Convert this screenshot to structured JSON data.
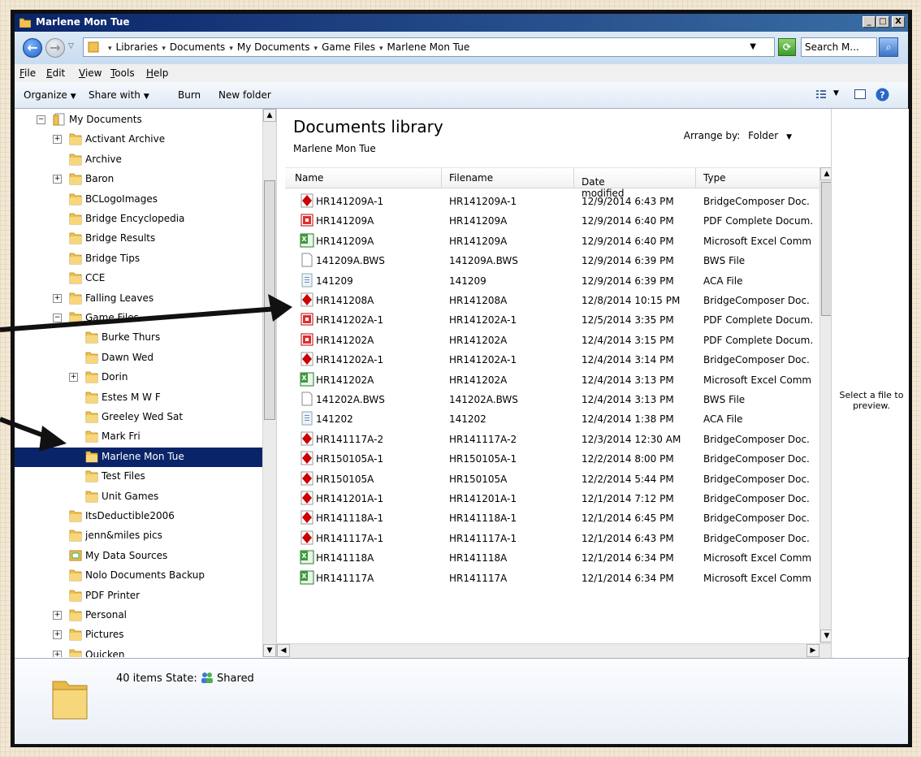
{
  "window": {
    "title": "Marlene Mon Tue",
    "controls": {
      "minimize": "_",
      "maximize": "□",
      "close": "X"
    }
  },
  "address": {
    "breadcrumbs": [
      "Libraries",
      "Documents",
      "My Documents",
      "Game Files",
      "Marlene Mon Tue"
    ],
    "search_text": "Search M..."
  },
  "menu": [
    "File",
    "Edit",
    "View",
    "Tools",
    "Help"
  ],
  "toolbar": {
    "organize": "Organize",
    "share_with": "Share with",
    "burn": "Burn",
    "new_folder": "New folder"
  },
  "nav": {
    "items": [
      {
        "label": "My Documents",
        "indent": 0,
        "expander": "⊟",
        "icon": "documents-icon"
      },
      {
        "label": "Activant Archive",
        "indent": 1,
        "expander": "⊞",
        "icon": "folder-icon"
      },
      {
        "label": "Archive",
        "indent": 1,
        "expander": "",
        "icon": "folder-icon"
      },
      {
        "label": "Baron",
        "indent": 1,
        "expander": "⊞",
        "icon": "folder-icon"
      },
      {
        "label": "BCLogoImages",
        "indent": 1,
        "expander": "",
        "icon": "folder-icon"
      },
      {
        "label": "Bridge Encyclopedia",
        "indent": 1,
        "expander": "",
        "icon": "folder-icon"
      },
      {
        "label": "Bridge Results",
        "indent": 1,
        "expander": "",
        "icon": "folder-icon"
      },
      {
        "label": "Bridge Tips",
        "indent": 1,
        "expander": "",
        "icon": "folder-icon"
      },
      {
        "label": "CCE",
        "indent": 1,
        "expander": "",
        "icon": "folder-icon"
      },
      {
        "label": "Falling Leaves",
        "indent": 1,
        "expander": "⊞",
        "icon": "folder-icon"
      },
      {
        "label": "Game Files",
        "indent": 1,
        "expander": "⊟",
        "icon": "folder-icon"
      },
      {
        "label": "Burke Thurs",
        "indent": 2,
        "expander": "",
        "icon": "folder-icon"
      },
      {
        "label": "Dawn Wed",
        "indent": 2,
        "expander": "",
        "icon": "folder-icon"
      },
      {
        "label": "Dorin",
        "indent": 2,
        "expander": "⊞",
        "icon": "folder-icon"
      },
      {
        "label": "Estes M W F",
        "indent": 2,
        "expander": "",
        "icon": "folder-icon"
      },
      {
        "label": "Greeley Wed Sat",
        "indent": 2,
        "expander": "",
        "icon": "folder-icon"
      },
      {
        "label": "Mark Fri",
        "indent": 2,
        "expander": "",
        "icon": "folder-icon"
      },
      {
        "label": "Marlene Mon Tue",
        "indent": 2,
        "expander": "",
        "icon": "folder-icon",
        "selected": true
      },
      {
        "label": "Test Files",
        "indent": 2,
        "expander": "",
        "icon": "folder-icon"
      },
      {
        "label": "Unit Games",
        "indent": 2,
        "expander": "",
        "icon": "folder-icon"
      },
      {
        "label": "ItsDeductible2006",
        "indent": 1,
        "expander": "",
        "icon": "folder-icon"
      },
      {
        "label": "jenn&miles pics",
        "indent": 1,
        "expander": "",
        "icon": "folder-icon"
      },
      {
        "label": "My Data Sources",
        "indent": 1,
        "expander": "",
        "icon": "data-sources-icon"
      },
      {
        "label": "Nolo Documents Backup",
        "indent": 1,
        "expander": "",
        "icon": "folder-icon"
      },
      {
        "label": "PDF Printer",
        "indent": 1,
        "expander": "",
        "icon": "folder-icon"
      },
      {
        "label": "Personal",
        "indent": 1,
        "expander": "⊞",
        "icon": "folder-icon"
      },
      {
        "label": "Pictures",
        "indent": 1,
        "expander": "⊞",
        "icon": "folder-icon"
      },
      {
        "label": "Quicken",
        "indent": 1,
        "expander": "⊞",
        "icon": "folder-icon"
      }
    ]
  },
  "library": {
    "title": "Documents library",
    "subtitle": "Marlene Mon Tue",
    "arrange_label": "Arrange by:",
    "arrange_value": "Folder"
  },
  "columns": [
    "Name",
    "Filename",
    "Date modified",
    "Type"
  ],
  "files": [
    {
      "name": "HR141209A-1",
      "filename": "HR141209A-1",
      "date": "12/9/2014 6:43 PM",
      "type": "BridgeComposer Doc.",
      "icon": "bridgecomposer-icon"
    },
    {
      "name": "HR141209A",
      "filename": "HR141209A",
      "date": "12/9/2014 6:40 PM",
      "type": "PDF Complete Docum.",
      "icon": "pdf-icon"
    },
    {
      "name": "HR141209A",
      "filename": "HR141209A",
      "date": "12/9/2014 6:40 PM",
      "type": "Microsoft Excel Comm",
      "icon": "excel-icon"
    },
    {
      "name": "141209A.BWS",
      "filename": "141209A.BWS",
      "date": "12/9/2014 6:39 PM",
      "type": "BWS File",
      "icon": "blank-file-icon"
    },
    {
      "name": "141209",
      "filename": "141209",
      "date": "12/9/2014 6:39 PM",
      "type": "ACA File",
      "icon": "aca-file-icon"
    },
    {
      "name": "HR141208A",
      "filename": "HR141208A",
      "date": "12/8/2014 10:15 PM",
      "type": "BridgeComposer Doc.",
      "icon": "bridgecomposer-icon"
    },
    {
      "name": "HR141202A-1",
      "filename": "HR141202A-1",
      "date": "12/5/2014 3:35 PM",
      "type": "PDF Complete Docum.",
      "icon": "pdf-icon"
    },
    {
      "name": "HR141202A",
      "filename": "HR141202A",
      "date": "12/4/2014 3:15 PM",
      "type": "PDF Complete Docum.",
      "icon": "pdf-icon"
    },
    {
      "name": "HR141202A-1",
      "filename": "HR141202A-1",
      "date": "12/4/2014 3:14 PM",
      "type": "BridgeComposer Doc.",
      "icon": "bridgecomposer-icon"
    },
    {
      "name": "HR141202A",
      "filename": "HR141202A",
      "date": "12/4/2014 3:13 PM",
      "type": "Microsoft Excel Comm",
      "icon": "excel-icon"
    },
    {
      "name": "141202A.BWS",
      "filename": "141202A.BWS",
      "date": "12/4/2014 3:13 PM",
      "type": "BWS File",
      "icon": "blank-file-icon"
    },
    {
      "name": "141202",
      "filename": "141202",
      "date": "12/4/2014 1:38 PM",
      "type": "ACA File",
      "icon": "aca-file-icon"
    },
    {
      "name": "HR141117A-2",
      "filename": "HR141117A-2",
      "date": "12/3/2014 12:30 AM",
      "type": "BridgeComposer Doc.",
      "icon": "bridgecomposer-icon"
    },
    {
      "name": "HR150105A-1",
      "filename": "HR150105A-1",
      "date": "12/2/2014 8:00 PM",
      "type": "BridgeComposer Doc.",
      "icon": "bridgecomposer-icon"
    },
    {
      "name": "HR150105A",
      "filename": "HR150105A",
      "date": "12/2/2014 5:44 PM",
      "type": "BridgeComposer Doc.",
      "icon": "bridgecomposer-icon"
    },
    {
      "name": "HR141201A-1",
      "filename": "HR141201A-1",
      "date": "12/1/2014 7:12 PM",
      "type": "BridgeComposer Doc.",
      "icon": "bridgecomposer-icon"
    },
    {
      "name": "HR141118A-1",
      "filename": "HR141118A-1",
      "date": "12/1/2014 6:45 PM",
      "type": "BridgeComposer Doc.",
      "icon": "bridgecomposer-icon"
    },
    {
      "name": "HR141117A-1",
      "filename": "HR141117A-1",
      "date": "12/1/2014 6:43 PM",
      "type": "BridgeComposer Doc.",
      "icon": "bridgecomposer-icon"
    },
    {
      "name": "HR141118A",
      "filename": "HR141118A",
      "date": "12/1/2014 6:34 PM",
      "type": "Microsoft Excel Comm",
      "icon": "excel-icon"
    },
    {
      "name": "HR141117A",
      "filename": "HR141117A",
      "date": "12/1/2014 6:34 PM",
      "type": "Microsoft Excel Comm",
      "icon": "excel-icon"
    }
  ],
  "preview": {
    "text": "Select a file to preview."
  },
  "status": {
    "items": "40 items",
    "state_label": "State:",
    "state_value": "Shared"
  },
  "colors": {
    "selection": "#0a246a",
    "folder": "#f2c14e",
    "bridgecomposer": "#cc0000"
  }
}
